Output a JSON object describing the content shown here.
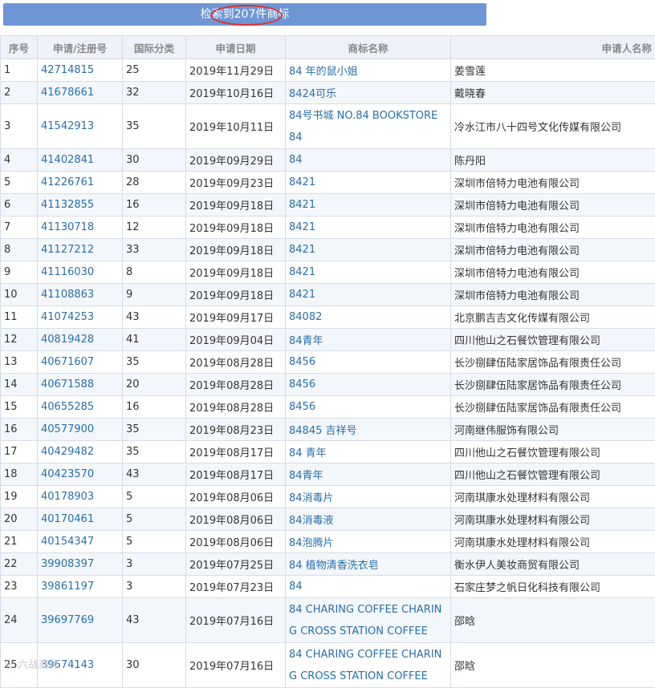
{
  "banner": {
    "text": "检索到207件商标"
  },
  "columns": [
    "序号",
    "申请/注册号",
    "国际分类",
    "申请日期",
    "商标名称",
    "申请人名称"
  ],
  "rows": [
    {
      "no": "1",
      "reg": "42714815",
      "cls": "25",
      "date": "2019年11月29日",
      "name": "84 年的鼠小姐",
      "applicant": "姜雪莲"
    },
    {
      "no": "2",
      "reg": "41678661",
      "cls": "32",
      "date": "2019年10月16日",
      "name": "8424可乐",
      "applicant": "戴晓春"
    },
    {
      "no": "3",
      "reg": "41542913",
      "cls": "35",
      "date": "2019年10月11日",
      "name": "84号书城 NO.84 BOOKSTORE 84",
      "applicant": "冷水江市八十四号文化传媒有限公司"
    },
    {
      "no": "4",
      "reg": "41402841",
      "cls": "30",
      "date": "2019年09月29日",
      "name": "84",
      "applicant": "陈丹阳"
    },
    {
      "no": "5",
      "reg": "41226761",
      "cls": "28",
      "date": "2019年09月23日",
      "name": "8421",
      "applicant": "深圳市倍特力电池有限公司"
    },
    {
      "no": "6",
      "reg": "41132855",
      "cls": "16",
      "date": "2019年09月18日",
      "name": "8421",
      "applicant": "深圳市倍特力电池有限公司"
    },
    {
      "no": "7",
      "reg": "41130718",
      "cls": "12",
      "date": "2019年09月18日",
      "name": "8421",
      "applicant": "深圳市倍特力电池有限公司"
    },
    {
      "no": "8",
      "reg": "41127212",
      "cls": "33",
      "date": "2019年09月18日",
      "name": "8421",
      "applicant": "深圳市倍特力电池有限公司"
    },
    {
      "no": "9",
      "reg": "41116030",
      "cls": "8",
      "date": "2019年09月18日",
      "name": "8421",
      "applicant": "深圳市倍特力电池有限公司"
    },
    {
      "no": "10",
      "reg": "41108863",
      "cls": "9",
      "date": "2019年09月18日",
      "name": "8421",
      "applicant": "深圳市倍特力电池有限公司"
    },
    {
      "no": "11",
      "reg": "41074253",
      "cls": "43",
      "date": "2019年09月17日",
      "name": "84082",
      "applicant": "北京鹏吉吉文化传媒有限公司"
    },
    {
      "no": "12",
      "reg": "40819428",
      "cls": "41",
      "date": "2019年09月04日",
      "name": "84青年",
      "applicant": "四川他山之石餐饮管理有限公司"
    },
    {
      "no": "13",
      "reg": "40671607",
      "cls": "35",
      "date": "2019年08月28日",
      "name": "8456",
      "applicant": "长沙捌肆伍陆家居饰品有限责任公司"
    },
    {
      "no": "14",
      "reg": "40671588",
      "cls": "20",
      "date": "2019年08月28日",
      "name": "8456",
      "applicant": "长沙捌肆伍陆家居饰品有限责任公司"
    },
    {
      "no": "15",
      "reg": "40655285",
      "cls": "16",
      "date": "2019年08月28日",
      "name": "8456",
      "applicant": "长沙捌肆伍陆家居饰品有限责任公司"
    },
    {
      "no": "16",
      "reg": "40577900",
      "cls": "35",
      "date": "2019年08月23日",
      "name": "84845 吉祥号",
      "applicant": "河南继伟服饰有限公司"
    },
    {
      "no": "17",
      "reg": "40429482",
      "cls": "35",
      "date": "2019年08月17日",
      "name": "84 青年",
      "applicant": "四川他山之石餐饮管理有限公司"
    },
    {
      "no": "18",
      "reg": "40423570",
      "cls": "43",
      "date": "2019年08月17日",
      "name": "84青年",
      "applicant": "四川他山之石餐饮管理有限公司"
    },
    {
      "no": "19",
      "reg": "40178903",
      "cls": "5",
      "date": "2019年08月06日",
      "name": "84消毒片",
      "applicant": "河南琪康水处理材料有限公司"
    },
    {
      "no": "20",
      "reg": "40170461",
      "cls": "5",
      "date": "2019年08月06日",
      "name": "84消毒液",
      "applicant": "河南琪康水处理材料有限公司"
    },
    {
      "no": "21",
      "reg": "40154347",
      "cls": "5",
      "date": "2019年08月06日",
      "name": "84泡腾片",
      "applicant": "河南琪康水处理材料有限公司"
    },
    {
      "no": "22",
      "reg": "39908397",
      "cls": "3",
      "date": "2019年07月25日",
      "name": "84 植物清香洗衣皂",
      "applicant": "衡水伊人美妆商贸有限公司"
    },
    {
      "no": "23",
      "reg": "39861197",
      "cls": "3",
      "date": "2019年07月23日",
      "name": "84",
      "applicant": "石家庄梦之帆日化科技有限公司"
    },
    {
      "no": "24",
      "reg": "39697769",
      "cls": "43",
      "date": "2019年07月16日",
      "name": "84 CHARING COFFEE CHARING CROSS STATION COFFEE",
      "applicant": "邵晗"
    },
    {
      "no": "25",
      "reg": "39674143",
      "cls": "30",
      "date": "2019年07月16日",
      "name": "84 CHARING COFFEE CHARING CROSS STATION COFFEE",
      "applicant": "邵晗"
    }
  ],
  "watermark": {
    "icon": "weibo-icon",
    "text": "六战商标"
  }
}
